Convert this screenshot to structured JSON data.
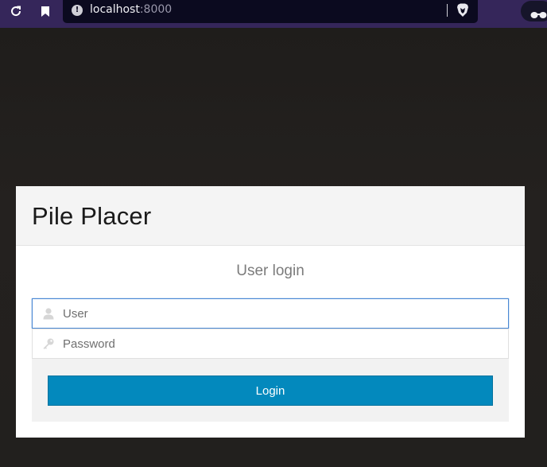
{
  "browser": {
    "url_host": "localhost",
    "url_port": ":8000",
    "icons": [
      "reload-icon",
      "bookmark-icon",
      "site-info-icon",
      "brave-shield-icon",
      "private-glasses-icon"
    ]
  },
  "app": {
    "title": "Pile Placer"
  },
  "login": {
    "heading": "User login",
    "user_placeholder": "User",
    "password_placeholder": "Password",
    "submit_label": "Login"
  },
  "colors": {
    "chrome_bg": "#35265a",
    "urlbar_bg": "#0b0a1f",
    "page_bg": "#22201e",
    "accent": "#0389bd",
    "focus_border": "#4a88d4"
  }
}
